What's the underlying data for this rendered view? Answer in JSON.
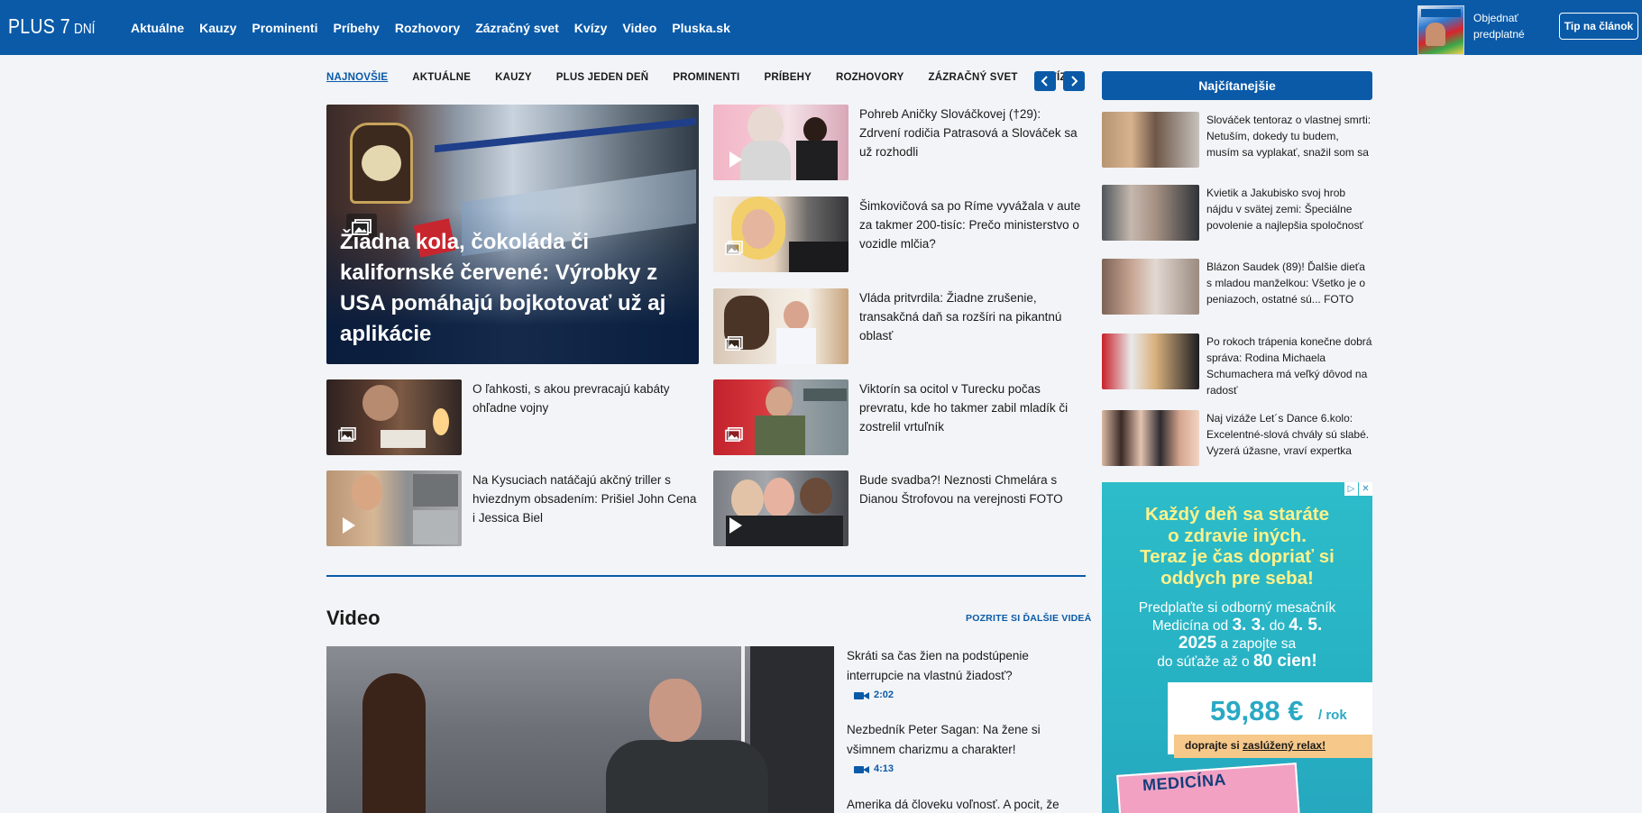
{
  "header": {
    "logo_big": "PLUS 7",
    "logo_small": "DNÍ",
    "nav": [
      "Aktuálne",
      "Kauzy",
      "Prominenti",
      "Príbehy",
      "Rozhovory",
      "Zázračný svet",
      "Kvízy",
      "Video",
      "Pluska.sk"
    ],
    "subscribe_line1": "Objednať",
    "subscribe_line2": "predplatné",
    "tip_button": "Tip na článok"
  },
  "subnav": {
    "items": [
      "NAJNOVŠIE",
      "AKTUÁLNE",
      "KAUZY",
      "PLUS JEDEN DEŇ",
      "PROMINENTI",
      "PRÍBEHY",
      "ROZHOVORY",
      "ZÁZRAČNÝ SVET",
      "KVÍZY"
    ],
    "active": "NAJNOVŠIE",
    "prev": "‹",
    "next": "›"
  },
  "hero": {
    "title": "Žiadna kola, čokoláda či kalifornské červené: Výrobky z USA pomáhajú bojkotovať už aj aplikácie",
    "media": "gallery"
  },
  "articles": {
    "a1": {
      "title": "Pohreb Aničky Slováčkovej (†29): Zdrvení rodičia Patrasová a Slováček sa už rozhodli",
      "media": "video"
    },
    "a2": {
      "title": "Šimkovičová sa po Ríme vyvážala v aute za takmer 200-tisíc: Prečo ministerstvo o vozidle mlčia?",
      "media": "gallery"
    },
    "a3": {
      "title": "Vláda pritvrdila: Žiadne zrušenie, transakčná daň sa rozšíri na pikantnú oblasť",
      "media": "gallery"
    },
    "a4": {
      "title": "O ľahkosti, s akou prevracajú kabáty ohľadne vojny",
      "media": "gallery"
    },
    "a5": {
      "title": "Viktorín sa ocitol v Turecku počas prevratu, kde ho takmer zabil mladík či zostrelil vrtuľník",
      "media": "gallery"
    },
    "a6": {
      "title": "Na Kysuciach natáčajú akčný triller s hviezdnym obsadením: Prišiel John Cena i Jessica Biel",
      "media": "video"
    },
    "a7": {
      "title": "Bude svadba?! Neznosti Chmelára s Dianou Štrofovou na verejnosti FOTO",
      "media": "video"
    }
  },
  "video_section": {
    "title": "Video",
    "more": "POZRITE SI ĎALŠIE VIDEÁ",
    "items": [
      {
        "title": "Skráti sa čas žien na podstúpenie interrupcie na vlastnú žiadosť?",
        "duration": "2:02"
      },
      {
        "title": "Nezbedník Peter Sagan: Na žene si všimnem charizmu a charakter!",
        "duration": "4:13"
      },
      {
        "title": "Amerika dá človeku voľnosť. A pocit, že",
        "duration": ""
      }
    ]
  },
  "sidebar": {
    "title": "Najčítanejšie",
    "items": [
      {
        "text": "Slováček tentoraz o vlastnej smrti: Netuším, dokedy tu budem, musím sa vyplakať, snažil som sa"
      },
      {
        "text": "Kvietik a Jakubisko svoj hrob nájdu v svätej zemi: Špeciálne povolenie a najlepšia spoločnosť"
      },
      {
        "text": "Blázon Saudek (89)! Ďalšie dieťa s mladou manželkou: Všetko je o peniazoch, ostatné sú... FOTO"
      },
      {
        "text": "Po rokoch trápenia konečne dobrá správa: Rodina Michaela Schumachera má veľký dôvod na radosť"
      },
      {
        "text": "Naj vizáže Let´s Dance 6.kolo: Excelentné-slová chvály sú slabé. Vyzerá úžasne, vraví expertka"
      }
    ]
  },
  "ad": {
    "headline_1": "Každý deň sa staráte",
    "headline_2": "o zdravie iných.",
    "headline_3": "Teraz je čas dopriať si",
    "headline_4": "oddych pre seba!",
    "line1": "Predplaťte si odborný mesačník",
    "line2_a": "Medicína od ",
    "date1": "3. 3.",
    "line2_b": " do ",
    "date2": "4. 5.",
    "year": "2025",
    "line3_b": " a zapojte sa",
    "line4_a": "do súťaže až o ",
    "count": "80 cien!",
    "price": "59,88 €",
    "per": "/ rok",
    "relax_a": "doprajte si ",
    "relax_b": "zaslúžený relax!",
    "magazine": "MEDICÍNA",
    "choices_icon": "▷",
    "close_icon": "✕"
  },
  "colors": {
    "brand": "#0a5aa8",
    "background": "#f2f4f7",
    "ad_bg": "#2dbcc9",
    "ad_headline": "#fff28a"
  }
}
